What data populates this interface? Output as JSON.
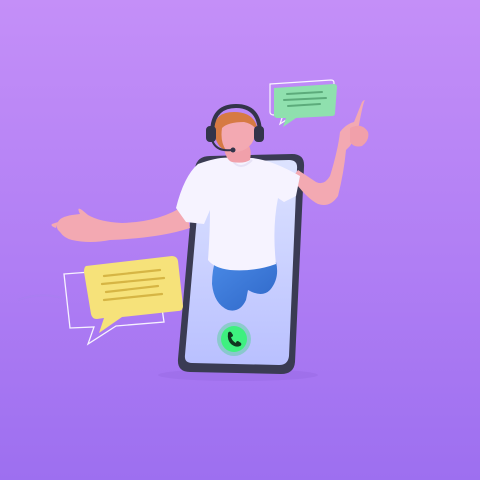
{
  "scene": {
    "background_top": "#c48ff8",
    "background_bottom": "#9d6ff0",
    "phone_body": "#3a3b53",
    "phone_screen": "#cfd3ff",
    "call_button": "#3ef07f",
    "shirt": "#f6f3ff",
    "pants": "#3d7dd8",
    "skin": "#f3a9b2",
    "hair": "#d67a43",
    "headset": "#33344a",
    "bubble_green": "#8fe0ae",
    "bubble_yellow": "#f6e27a",
    "icons": [
      "phone-icon",
      "chat-bubble-icon"
    ]
  }
}
